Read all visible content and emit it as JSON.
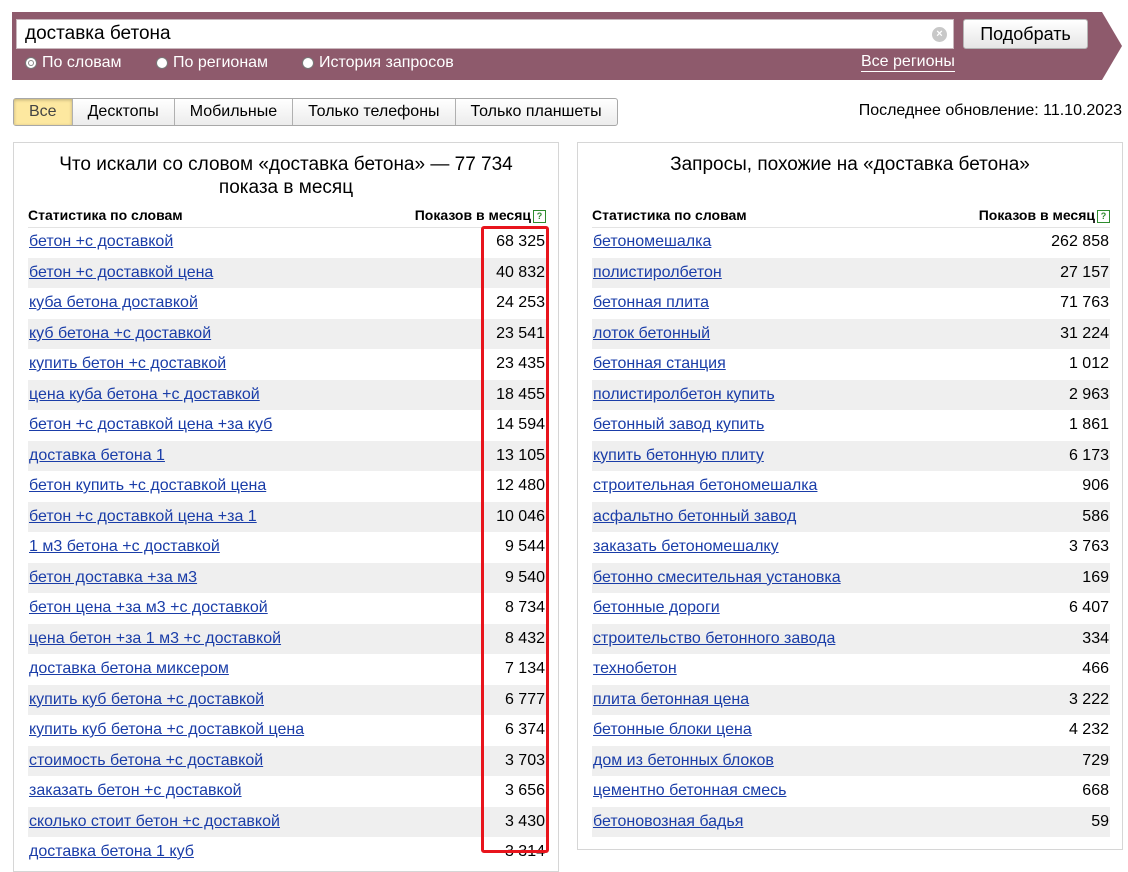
{
  "search": {
    "query": "доставка бетона",
    "submit_label": "Подобрать",
    "modes": [
      "По словам",
      "По регионам",
      "История запросов"
    ],
    "selected_mode": "По словам",
    "regions_link": "Все регионы"
  },
  "tabs": {
    "items": [
      "Все",
      "Десктопы",
      "Мобильные",
      "Только телефоны",
      "Только планшеты"
    ],
    "active": "Все"
  },
  "last_update": "Последнее обновление: 11.10.2023",
  "left_panel": {
    "title": "Что искали со словом «доставка бетона» — 77 734 показа в месяц",
    "col_phrase": "Статистика по словам",
    "col_count": "Показов в месяц",
    "rows": [
      {
        "phrase": "бетон +с доставкой",
        "count": "68 325"
      },
      {
        "phrase": "бетон +с доставкой цена",
        "count": "40 832"
      },
      {
        "phrase": "куба бетона доставкой",
        "count": "24 253"
      },
      {
        "phrase": "куб бетона +с доставкой",
        "count": "23 541"
      },
      {
        "phrase": "купить бетон +с доставкой",
        "count": "23 435"
      },
      {
        "phrase": "цена куба бетона +с доставкой",
        "count": "18 455"
      },
      {
        "phrase": "бетон +с доставкой цена +за куб",
        "count": "14 594"
      },
      {
        "phrase": "доставка бетона 1",
        "count": "13 105"
      },
      {
        "phrase": "бетон купить +с доставкой цена",
        "count": "12 480"
      },
      {
        "phrase": "бетон +с доставкой цена +за 1",
        "count": "10 046"
      },
      {
        "phrase": "1 м3 бетона +с доставкой",
        "count": "9 544"
      },
      {
        "phrase": "бетон доставка +за м3",
        "count": "9 540"
      },
      {
        "phrase": "бетон цена +за м3 +с доставкой",
        "count": "8 734"
      },
      {
        "phrase": "цена бетон +за 1 м3 +с доставкой",
        "count": "8 432"
      },
      {
        "phrase": "доставка бетона миксером",
        "count": "7 134"
      },
      {
        "phrase": "купить куб бетона +с доставкой",
        "count": "6 777"
      },
      {
        "phrase": "купить куб бетона +с доставкой цена",
        "count": "6 374"
      },
      {
        "phrase": "стоимость бетона +с доставкой",
        "count": "3 703"
      },
      {
        "phrase": "заказать бетон +с доставкой",
        "count": "3 656"
      },
      {
        "phrase": "сколько стоит бетон +с доставкой",
        "count": "3 430"
      },
      {
        "phrase": "доставка бетона 1 куб",
        "count": "3 314"
      }
    ]
  },
  "right_panel": {
    "title": "Запросы, похожие на «доставка бетона»",
    "col_phrase": "Статистика по словам",
    "col_count": "Показов в месяц",
    "rows": [
      {
        "phrase": "бетономешалка",
        "count": "262 858"
      },
      {
        "phrase": "полистиролбетон",
        "count": "27 157"
      },
      {
        "phrase": "бетонная плита",
        "count": "71 763"
      },
      {
        "phrase": "лоток бетонный",
        "count": "31 224"
      },
      {
        "phrase": "бетонная станция",
        "count": "1 012"
      },
      {
        "phrase": "полистиролбетон купить",
        "count": "2 963"
      },
      {
        "phrase": "бетонный завод купить",
        "count": "1 861"
      },
      {
        "phrase": "купить бетонную плиту",
        "count": "6 173"
      },
      {
        "phrase": "строительная бетономешалка",
        "count": "906"
      },
      {
        "phrase": "асфальтно бетонный завод",
        "count": "586"
      },
      {
        "phrase": "заказать бетономешалку",
        "count": "3 763"
      },
      {
        "phrase": "бетонно смесительная установка",
        "count": "169"
      },
      {
        "phrase": "бетонные дороги",
        "count": "6 407"
      },
      {
        "phrase": "строительство бетонного завода",
        "count": "334"
      },
      {
        "phrase": "технобетон",
        "count": "466"
      },
      {
        "phrase": "плита бетонная цена",
        "count": "3 222"
      },
      {
        "phrase": "бетонные блоки цена",
        "count": "4 232"
      },
      {
        "phrase": "дом из бетонных блоков",
        "count": "729"
      },
      {
        "phrase": "цементно бетонная смесь",
        "count": "668"
      },
      {
        "phrase": "бетоновозная бадья",
        "count": "59"
      }
    ]
  },
  "icons": {
    "clear": "clear-icon",
    "help": "help-icon"
  },
  "colors": {
    "band": "#8e5a6c",
    "link": "#1a3da8",
    "highlight": "#e8141c",
    "active_tab": "#fde8a0"
  }
}
